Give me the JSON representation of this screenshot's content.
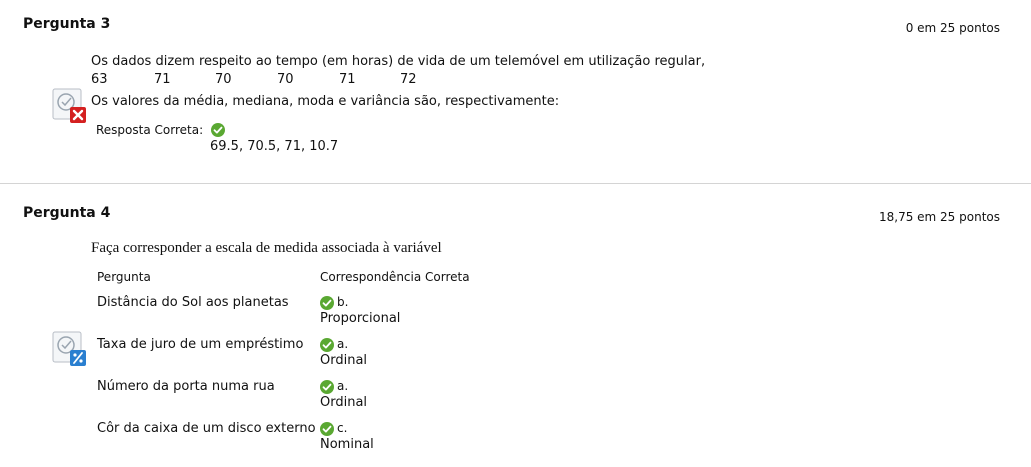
{
  "q3": {
    "title": "Pergunta 3",
    "points": "0 em 25 pontos",
    "question_line1": "Os dados dizem respeito ao tempo (em horas) de vida de um telemóvel em utilização regular,",
    "data_values": [
      "63",
      "71",
      "70",
      "70",
      "71",
      "72"
    ],
    "question_line2": "Os valores da média, mediana, moda e variância são, respectivamente:",
    "answer_label": "Resposta Correta:",
    "answer_value": "69.5, 70.5, 71, 10.7",
    "status_icon": "incorrect-icon"
  },
  "q4": {
    "title": "Pergunta 4",
    "points": "18,75 em 25 pontos",
    "prompt": "Faça corresponder a escala de medida associada à variável",
    "col_question": "Pergunta",
    "col_answer": "Correspondência Correta",
    "rows": [
      {
        "question": "Distância do Sol aos planetas",
        "letter": "b.",
        "answer": "Proporcional"
      },
      {
        "question": "Taxa de juro de um empréstimo",
        "letter": "a.",
        "answer": "Ordinal"
      },
      {
        "question": "Número da porta numa rua",
        "letter": "a.",
        "answer": "Ordinal"
      },
      {
        "question": "Côr da caixa de um disco externo",
        "letter": "c.",
        "answer": "Nominal"
      }
    ],
    "status_icon": "partial-credit-icon"
  },
  "colors": {
    "check_green": "#5aa832",
    "incorrect_red": "#d42020",
    "partial_blue": "#2a7fd0",
    "divider": "#d4d4d4"
  }
}
